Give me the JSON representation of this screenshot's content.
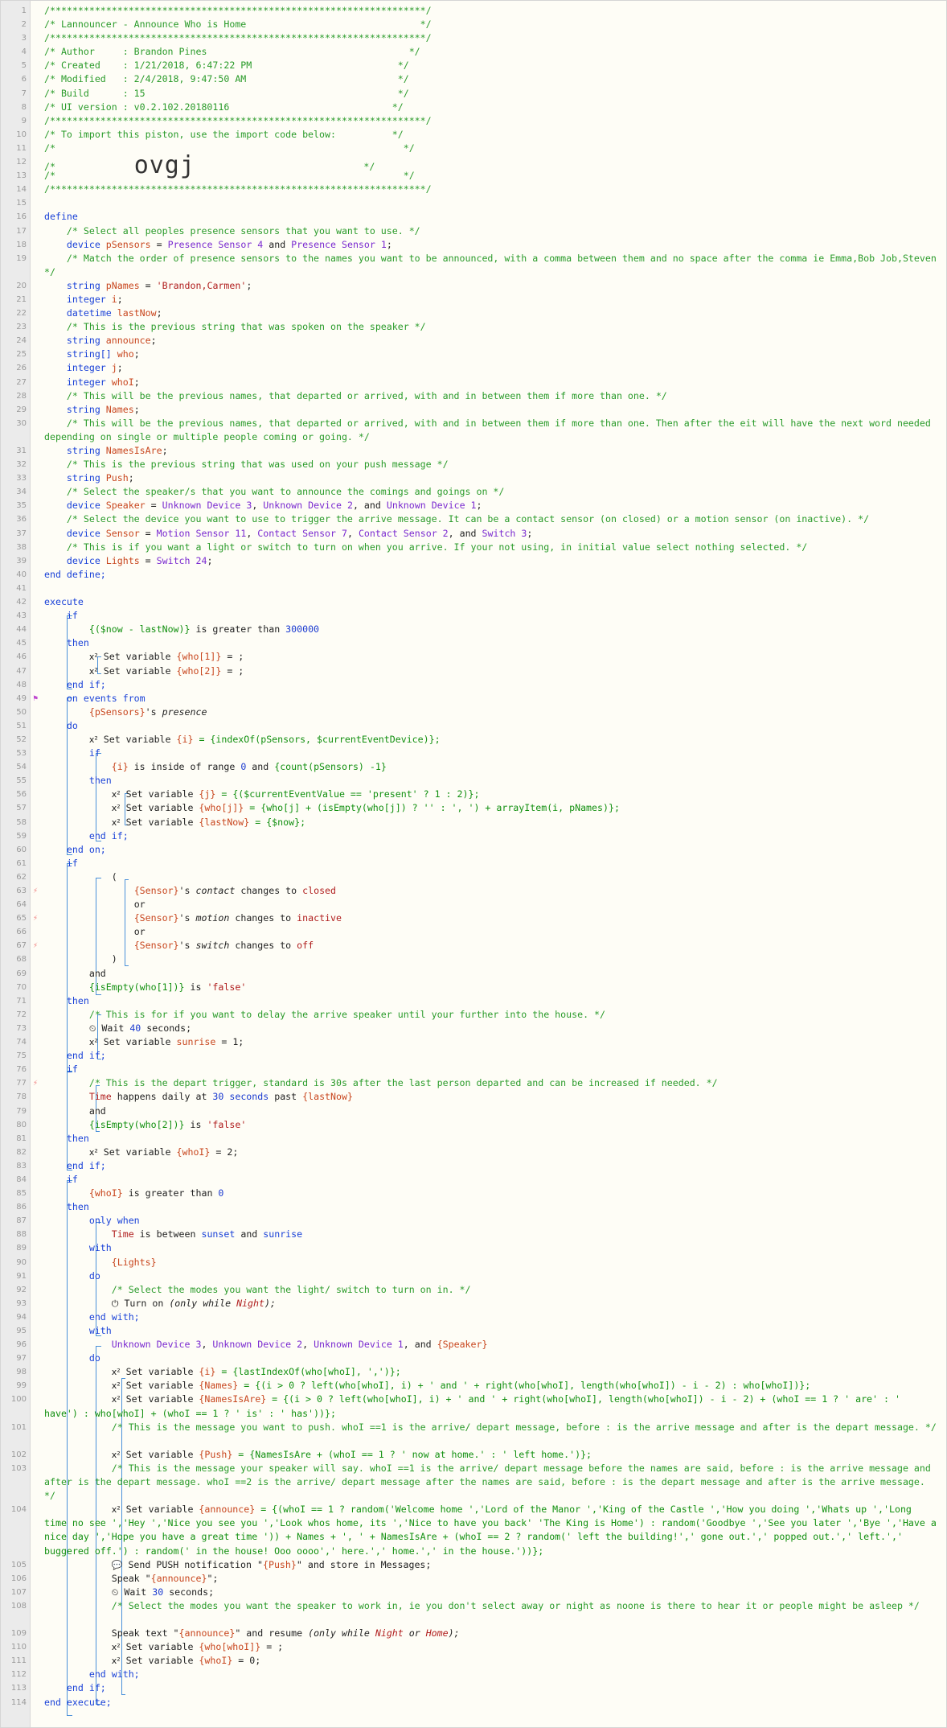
{
  "header": {
    "border": "/*******************************************************************/",
    "title": "/* Lannouncer - Announce Who is Home                               */",
    "author": "/* Author     : Brandon Pines                                    */",
    "created": "/* Created    : 1/21/2018, 6:47:22 PM                          */",
    "modified": "/* Modified   : 2/4/2018, 9:47:50 AM                           */",
    "build": "/* Build      : 15                                             */",
    "ui_version": "/* UI version : v0.2.102.20180116                             */",
    "import_note": "/* To import this piston, use the import code below:          */",
    "blank": "/*                                                              */",
    "import_prefix": "/*              ",
    "import_code": "ovgj",
    "import_suffix": "                              */"
  },
  "colors": {
    "comment": "#2a9b2a",
    "keyword": "#1a42d8",
    "variable": "#c8461e",
    "device": "#7a2ad0",
    "string": "#b01e1e"
  },
  "icons": {
    "set_variable": "superscript-x-icon",
    "wait": "clock-icon",
    "turn_on": "power-icon",
    "notification": "speech-bubble-icon",
    "trigger": "lightning-icon",
    "subscription": "flag-icon"
  },
  "lines": [
    "define",
    "/* Select all peoples presence sensors that you want to use. */",
    "device",
    "pSensors",
    "=",
    "Presence Sensor 4",
    "and",
    "Presence Sensor 1",
    ";",
    "/* Match the order of presence sensors to the names you want to be announced, with a comma between them and no space after the comma ie Emma,Bob Job,Steven */",
    "string",
    "pNames",
    "'Brandon,Carmen'",
    "integer",
    "i",
    "datetime",
    "lastNow",
    "/* This is the previous string that was spoken on the speaker */",
    "announce",
    "string[]",
    "who",
    "j",
    "whoI",
    "/* This will be the previous names, that departed or arrived, with and in between them if more than one. */",
    "Names",
    "/* This will be the previous names, that departed or arrived, with and in between them if more than one. Then after the eit will have the next word needed depending on single or multiple people coming or going. */",
    "NamesIsAre",
    "/* This is the previous string that was used on your push message */",
    "Push",
    "/* Select the speaker/s that you want to announce the comings and goings on */",
    "Speaker",
    "Unknown Device 3",
    "Unknown Device 2",
    "Unknown Device 1",
    "/* Select the device you want to use to trigger the arrive message. It can be a contact sensor (on closed) or a motion sensor (on inactive). */",
    "Sensor",
    "Motion Sensor 11",
    "Contact Sensor 7",
    "Contact Sensor 2",
    "Switch 3",
    "/* This is if you want a light or switch to turn on when you arrive. If your not using, in initial value select nothing selected. */",
    "Lights",
    "Switch 24",
    "end define;",
    "execute",
    "if",
    "{($now - lastNow)}",
    "is greater than",
    "300000",
    "then",
    "Set variable",
    "{who[1]}",
    "= ;",
    "{who[2]}",
    "end if;",
    "on events from",
    "{pSensors}",
    "'s",
    "presence",
    "do",
    "{i}",
    "= {indexOf(pSensors, $currentEventDevice)};",
    "is inside of range",
    "0",
    "{count(pSensors) -1}",
    "{j}",
    "= {($currentEventValue == 'present' ? 1 : 2)};",
    "{who[j]}",
    "= {who[j] + (isEmpty(who[j]) ? '' : ', ') + arrayItem(i, pNames)};",
    "{lastNow}",
    "= {$now};",
    "end on;",
    "(",
    "{Sensor}",
    "contact",
    "changes to",
    "closed",
    "or",
    "motion",
    "inactive",
    "switch",
    "off",
    ")",
    "{isEmpty(who[1])}",
    "is",
    "'false'",
    "/* This is for if you want to delay the arrive speaker until your further into the house. */",
    "Wait",
    "40",
    "seconds;",
    "= 1;",
    "/* This is the depart trigger, standard is 30s after the last person departed and can be increased if needed. */",
    "Time",
    "happens daily at",
    "30 seconds",
    "past",
    "{lastNow}",
    "{isEmpty(who[2])}",
    "= 2;",
    "{whoI}",
    "0",
    "only when",
    "is between",
    "sunset",
    "sunrise",
    "with",
    "{Lights}",
    "/* Select the modes you want the light/ switch to turn on in. */",
    "Turn on",
    "(only while ",
    "Night",
    ");",
    "end with;",
    "{Speaker}",
    "= {lastIndexOf(who[whoI], ',')};",
    "= {(i > 0 ? left(who[whoI], i) + ' and ' + right(who[whoI], length(who[whoI]) - i - 2) : who[whoI])};",
    "= {(i > 0 ? left(who[whoI], i) + ' and ' + right(who[whoI], length(who[whoI]) - i - 2) + (whoI == 1 ? ' are' : ' have') : who[whoI] + (whoI == 1 ? ' is' : ' has'))};",
    "/* This is the message you want to push. whoI ==1 is the arrive/ depart message, before : is the arrive message and after is the depart message. */",
    "{Push}",
    "= {NamesIsAre + (whoI == 1 ? ' now at home.' : ' left home.')};",
    "/* This is the message your speaker will say. whoI ==1 is the arrive/ depart message before the names are said, before : is the arrive message and after is the depart message. whoI ==2 is the arrive/ depart message after the names are said, before : is the depart message and after is the arrive message. */",
    "{announce}",
    "= {(whoI == 1 ? random('Welcome home ','Lord of the Manor ','King of the Castle ','How you doing ','Whats up ','Long time no see ','Hey ','Nice you see you ','Look whos home, its ','Nice to have you back' 'The King is Home') : random('Goodbye ','See you later ','Bye ','Have a nice day ','Hope you have a great time ')) + Names + ', ' + NamesIsAre + (whoI == 2 ? random(' left the building!',' gone out.',' popped out.',' left.',' buggered off.') : random(' in the house! Ooo oooo',' here.',' home.',' in the house.'))};",
    "Send PUSH notification \"",
    "\" and store in Messages;",
    "Speak \"",
    "\";",
    "Wait",
    "30",
    "/* Select the modes you want the speaker to work in, ie you don't select away or night as noone is there to hear it or people might be asleep */",
    "Speak text \"",
    "\" and resume",
    "(only while ",
    "Night",
    " or ",
    "Home",
    ");",
    "{who[whoI]}",
    "= ;",
    "{whoI}",
    "= 0;",
    "end if;",
    "end execute;"
  ]
}
